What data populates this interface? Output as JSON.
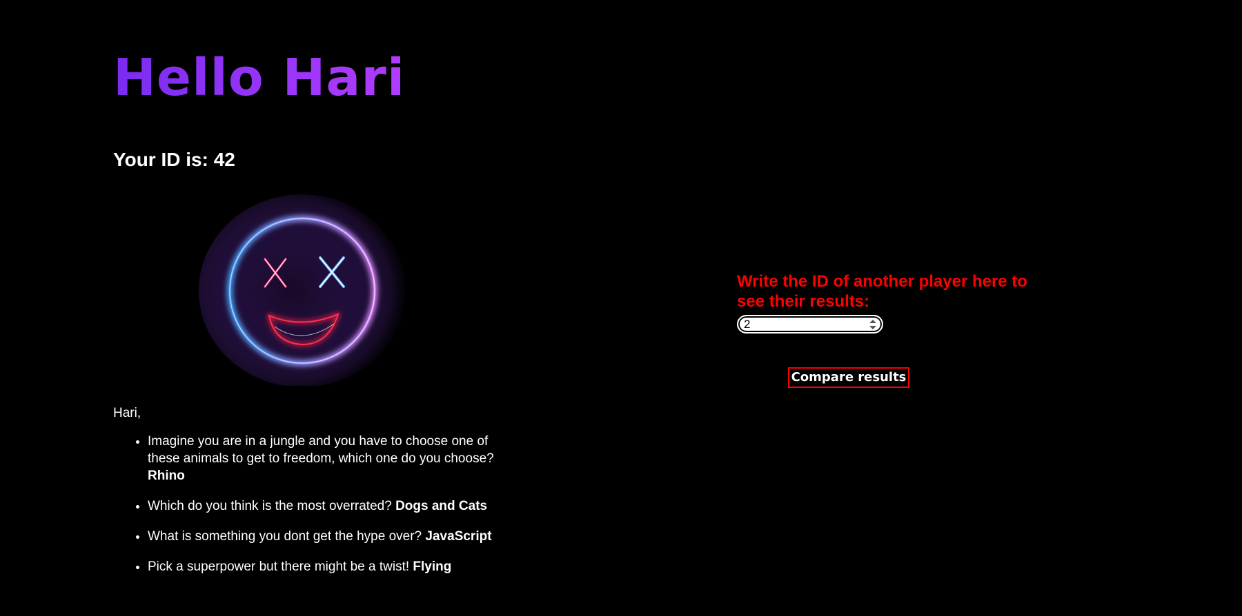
{
  "header": {
    "title": "Hello Hari"
  },
  "profile": {
    "id_text": "Your ID is: 42"
  },
  "emoji": {
    "name": "neon-smiley-x-eyes-icon"
  },
  "results": {
    "greeting": "Hari,",
    "items": [
      {
        "question": "Imagine you are in a jungle and you have to choose one of these animals to get to freedom, which one do you choose?",
        "answer": "Rhino"
      },
      {
        "question": "Which do you think is the most overrated?",
        "answer": "Dogs and Cats"
      },
      {
        "question": "What is something you dont get the hype over?",
        "answer": "JavaScript"
      },
      {
        "question": "Pick a superpower but there might be a twist!",
        "answer": "Flying"
      }
    ]
  },
  "compare": {
    "label": "Write the ID of another player here to see their results:",
    "input_value": "2",
    "button_label": "Compare results",
    "label_color": "#ff0000"
  }
}
